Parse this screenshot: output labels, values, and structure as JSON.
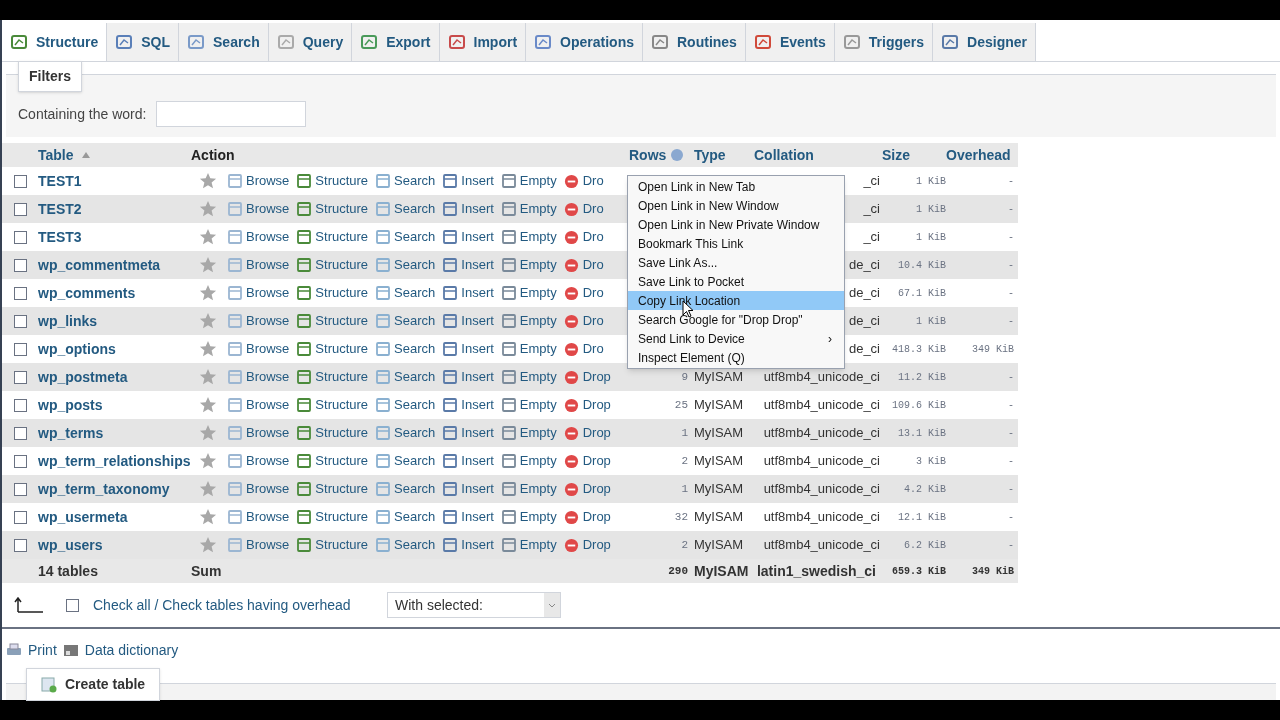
{
  "tabs": [
    {
      "label": "Structure",
      "selected": true
    },
    {
      "label": "SQL",
      "selected": false
    },
    {
      "label": "Search",
      "selected": false
    },
    {
      "label": "Query",
      "selected": false
    },
    {
      "label": "Export",
      "selected": false
    },
    {
      "label": "Import",
      "selected": false
    },
    {
      "label": "Operations",
      "selected": false
    },
    {
      "label": "Routines",
      "selected": false
    },
    {
      "label": "Events",
      "selected": false
    },
    {
      "label": "Triggers",
      "selected": false
    },
    {
      "label": "Designer",
      "selected": false
    }
  ],
  "filters": {
    "title": "Filters",
    "label": "Containing the word:"
  },
  "table": {
    "columns": [
      "Table",
      "Action",
      "Rows",
      "Type",
      "Collation",
      "Size",
      "Overhead"
    ],
    "rows": [
      {
        "checked": false,
        "name": "TEST1",
        "actions": [
          "Browse",
          "Structure",
          "Search",
          "Insert",
          "Empty"
        ],
        "drop": "Dro",
        "collation": "_ci",
        "size": "1 KiB",
        "overhead": "-"
      },
      {
        "checked": false,
        "name": "TEST2",
        "actions": [
          "Browse",
          "Structure",
          "Search",
          "Insert",
          "Empty"
        ],
        "drop": "Dro",
        "collation": "_ci",
        "size": "1 KiB",
        "overhead": "-"
      },
      {
        "checked": false,
        "name": "TEST3",
        "actions": [
          "Browse",
          "Structure",
          "Search",
          "Insert",
          "Empty"
        ],
        "drop": "Dro",
        "collation": "_ci",
        "size": "1 KiB",
        "overhead": "-"
      },
      {
        "checked": false,
        "name": "wp_commentmeta",
        "actions": [
          "Browse",
          "Structure",
          "Search",
          "Insert",
          "Empty"
        ],
        "drop": "Dro",
        "collation": "de_ci",
        "size": "10.4 KiB",
        "overhead": "-"
      },
      {
        "checked": false,
        "name": "wp_comments",
        "actions": [
          "Browse",
          "Structure",
          "Search",
          "Insert",
          "Empty"
        ],
        "drop": "Dro",
        "collation": "de_ci",
        "size": "67.1 KiB",
        "overhead": "-"
      },
      {
        "checked": false,
        "name": "wp_links",
        "actions": [
          "Browse",
          "Structure",
          "Search",
          "Insert",
          "Empty"
        ],
        "drop": "Dro",
        "collation": "de_ci",
        "size": "1 KiB",
        "overhead": "-"
      },
      {
        "checked": false,
        "name": "wp_options",
        "actions": [
          "Browse",
          "Structure",
          "Search",
          "Insert",
          "Empty"
        ],
        "drop": "Dro",
        "collation": "de_ci",
        "size": "418.3 KiB",
        "overhead": "349 KiB"
      },
      {
        "checked": false,
        "name": "wp_postmeta",
        "actions": [
          "Browse",
          "Structure",
          "Search",
          "Insert",
          "Empty"
        ],
        "drop": "Drop",
        "rows": "9",
        "type": "MyISAM",
        "collation": "utf8mb4_unicode_ci",
        "size": "11.2 KiB",
        "overhead": "-"
      },
      {
        "checked": false,
        "name": "wp_posts",
        "actions": [
          "Browse",
          "Structure",
          "Search",
          "Insert",
          "Empty"
        ],
        "drop": "Drop",
        "rows": "25",
        "type": "MyISAM",
        "collation": "utf8mb4_unicode_ci",
        "size": "109.6 KiB",
        "overhead": "-"
      },
      {
        "checked": false,
        "name": "wp_terms",
        "actions": [
          "Browse",
          "Structure",
          "Search",
          "Insert",
          "Empty"
        ],
        "drop": "Drop",
        "rows": "1",
        "type": "MyISAM",
        "collation": "utf8mb4_unicode_ci",
        "size": "13.1 KiB",
        "overhead": "-"
      },
      {
        "checked": false,
        "name": "wp_term_relationships",
        "actions": [
          "Browse",
          "Structure",
          "Search",
          "Insert",
          "Empty"
        ],
        "drop": "Drop",
        "rows": "2",
        "type": "MyISAM",
        "collation": "utf8mb4_unicode_ci",
        "size": "3 KiB",
        "overhead": "-"
      },
      {
        "checked": false,
        "name": "wp_term_taxonomy",
        "actions": [
          "Browse",
          "Structure",
          "Search",
          "Insert",
          "Empty"
        ],
        "drop": "Drop",
        "rows": "1",
        "type": "MyISAM",
        "collation": "utf8mb4_unicode_ci",
        "size": "4.2 KiB",
        "overhead": "-"
      },
      {
        "checked": false,
        "name": "wp_usermeta",
        "actions": [
          "Browse",
          "Structure",
          "Search",
          "Insert",
          "Empty"
        ],
        "drop": "Drop",
        "rows": "32",
        "type": "MyISAM",
        "collation": "utf8mb4_unicode_ci",
        "size": "12.1 KiB",
        "overhead": "-"
      },
      {
        "checked": false,
        "name": "wp_users",
        "actions": [
          "Browse",
          "Structure",
          "Search",
          "Insert",
          "Empty"
        ],
        "drop": "Drop",
        "rows": "2",
        "type": "MyISAM",
        "collation": "utf8mb4_unicode_ci",
        "size": "6.2 KiB",
        "overhead": "-"
      }
    ],
    "footer": {
      "count": "14 tables",
      "sum": "Sum",
      "rows": "290",
      "type": "MyISAM",
      "collation": "latin1_swedish_ci",
      "size": "659.3 KiB",
      "overhead": "349 KiB"
    }
  },
  "bulk": {
    "checked": false,
    "check_all": "Check all / Check tables having overhead",
    "with_selected": "With selected:"
  },
  "links": [
    "Print",
    "Data dictionary"
  ],
  "create_table": "Create table",
  "context_menu": [
    {
      "label": "Open Link in New Tab",
      "selected": false
    },
    {
      "label": "Open Link in New Window",
      "selected": false
    },
    {
      "label": "Open Link in New Private Window",
      "selected": false
    },
    {
      "label": "Bookmark This Link",
      "selected": false
    },
    {
      "label": "Save Link As...",
      "selected": false
    },
    {
      "label": "Save Link to Pocket",
      "selected": false
    },
    {
      "label": "Copy Link Location",
      "selected": true
    },
    {
      "label": "Search Google for \"Drop Drop\"",
      "selected": false
    },
    {
      "label": "Send Link to Device",
      "selected": false,
      "submenu": "›"
    },
    {
      "label": "Inspect Element (Q)",
      "selected": false
    }
  ]
}
